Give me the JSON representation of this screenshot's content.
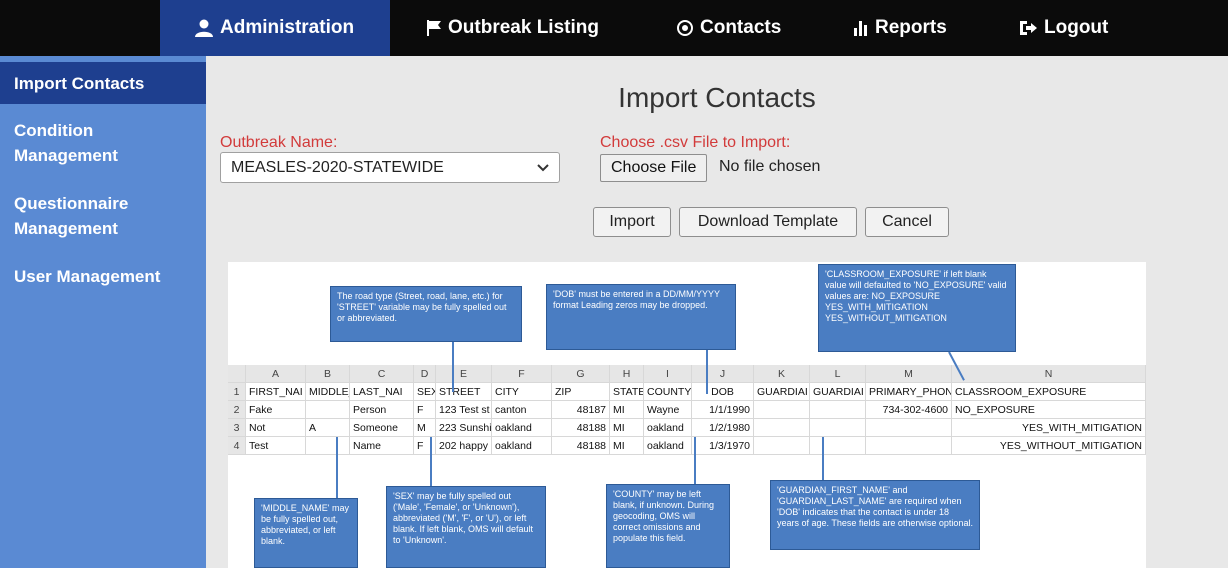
{
  "nav": {
    "items": [
      {
        "label": "Administration",
        "icon": "user-icon"
      },
      {
        "label": "Outbreak Listing",
        "icon": "flag-icon"
      },
      {
        "label": "Contacts",
        "icon": "target-icon"
      },
      {
        "label": "Reports",
        "icon": "bar-chart-icon"
      },
      {
        "label": "Logout",
        "icon": "logout-icon"
      }
    ]
  },
  "sidebar": {
    "items": [
      {
        "label": "Import Contacts"
      },
      {
        "label": "Condition Management"
      },
      {
        "label": "Questionnaire Management"
      },
      {
        "label": "User Management"
      }
    ]
  },
  "main": {
    "title": "Import Contacts",
    "outbreak_label": "Outbreak Name:",
    "outbreak_value": "MEASLES-2020-STATEWIDE",
    "file_label": "Choose .csv File to Import:",
    "file_button": "Choose File",
    "file_status": "No file chosen",
    "buttons": {
      "import": "Import",
      "download": "Download Template",
      "cancel": "Cancel"
    }
  },
  "template": {
    "column_letters": [
      "A",
      "B",
      "C",
      "D",
      "E",
      "F",
      "G",
      "H",
      "I",
      "J",
      "K",
      "L",
      "M",
      "N"
    ],
    "row_numbers": [
      "1",
      "2",
      "3",
      "4"
    ],
    "header": [
      "FIRST_NAI",
      "MIDDLE_",
      "LAST_NAI",
      "SEX",
      "STREET",
      "CITY",
      "ZIP",
      "STATE",
      "COUNTY",
      "DOB",
      "GUARDIAI",
      "GUARDIAI",
      "PRIMARY_PHON",
      "CLASSROOM_EXPOSURE"
    ],
    "rows": [
      [
        "Fake",
        "",
        "Person",
        "F",
        "123 Test st",
        "canton",
        "48187",
        "MI",
        "Wayne",
        "1/1/1990",
        "",
        "",
        "734-302-4600",
        "NO_EXPOSURE"
      ],
      [
        "Not",
        "A",
        "Someone",
        "M",
        "223 Sunshi",
        "oakland",
        "48188",
        "MI",
        "oakland",
        "1/2/1980",
        "",
        "",
        "",
        "YES_WITH_MITIGATION"
      ],
      [
        "Test",
        "",
        "Name",
        "F",
        "202 happy",
        "oakland",
        "48188",
        "MI",
        "oakland",
        "1/3/1970",
        "",
        "",
        "",
        "YES_WITHOUT_MITIGATION"
      ]
    ],
    "notes": {
      "street": "The road type (Street, road, lane, etc.) for 'STREET' variable may be fully spelled out or abbreviated.",
      "dob": "'DOB' must be entered in a DD/MM/YYYY format Leading zeros may be dropped.",
      "classroom": "'CLASSROOM_EXPOSURE' if left blank value will defaulted to 'NO_EXPOSURE' valid values are: NO_EXPOSURE YES_WITH_MITIGATION YES_WITHOUT_MITIGATION",
      "middle": "'MIDDLE_NAME' may be fully spelled out, abbreviated, or left blank.",
      "sex": "'SEX' may be fully spelled out ('Male', 'Female', or 'Unknown'), abbreviated ('M', 'F', or 'U'), or left blank. If left blank, OMS will default to 'Unknown'.",
      "county": "'COUNTY' may be left blank, if unknown. During geocoding, OMS will correct omissions and populate this field.",
      "guardian": "'GUARDIAN_FIRST_NAME' and 'GUARDIAN_LAST_NAME' are required when 'DOB' indicates that the contact is under 18 years of age. These fields are otherwise optional."
    }
  },
  "colors": {
    "topbar": "#0b0b0b",
    "active": "#1e3f8f",
    "sidebar": "#5a8ad3",
    "label_red": "#d23b3b",
    "note": "#4a7dc2"
  }
}
